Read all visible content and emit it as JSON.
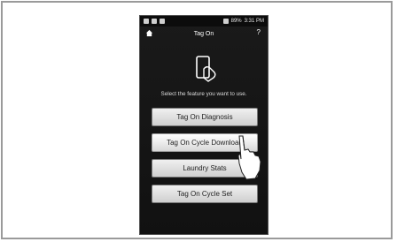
{
  "status_bar": {
    "time": "3:31 PM",
    "battery": "89%"
  },
  "header": {
    "title": "Tag On",
    "help": "?",
    "home_icon": "home-icon"
  },
  "main": {
    "illustration_icon": "tag-on-phone-icon",
    "prompt": "Select the feature you want to use.",
    "buttons": [
      {
        "label": "Tag On Diagnosis"
      },
      {
        "label": "Tag On Cycle Download"
      },
      {
        "label": "Laundry Stats"
      },
      {
        "label": "Tag On Cycle Set"
      }
    ]
  },
  "overlay": {
    "pointer_icon": "hand-pointer-icon"
  }
}
